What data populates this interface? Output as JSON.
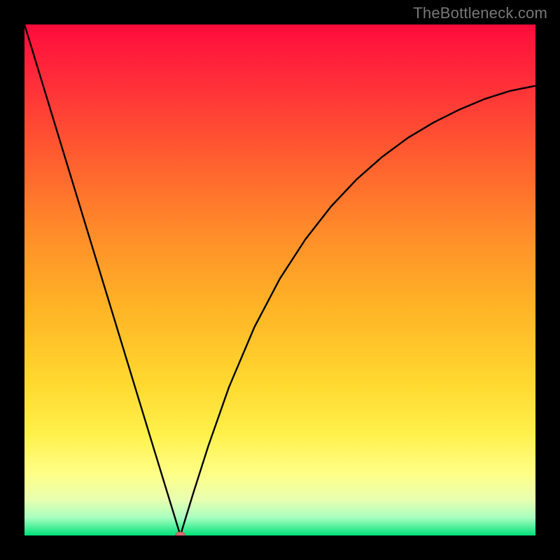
{
  "watermark": "TheBottleneck.com",
  "colors": {
    "frame": "#000000",
    "curve": "#000000",
    "marker_fill": "#d66e6f",
    "marker_stroke": "#c24e50",
    "gradient_stops": [
      {
        "offset": 0.0,
        "color": "#ff0b3c"
      },
      {
        "offset": 0.1,
        "color": "#ff2a3a"
      },
      {
        "offset": 0.25,
        "color": "#ff5a30"
      },
      {
        "offset": 0.4,
        "color": "#ff8a2a"
      },
      {
        "offset": 0.55,
        "color": "#ffb326"
      },
      {
        "offset": 0.7,
        "color": "#ffd82f"
      },
      {
        "offset": 0.8,
        "color": "#fff04a"
      },
      {
        "offset": 0.88,
        "color": "#ffff88"
      },
      {
        "offset": 0.93,
        "color": "#e8ffb0"
      },
      {
        "offset": 0.965,
        "color": "#a8ffc0"
      },
      {
        "offset": 1.0,
        "color": "#00e17a"
      }
    ]
  },
  "chart_data": {
    "type": "line",
    "title": "",
    "xlabel": "",
    "ylabel": "",
    "xlim": [
      0,
      1
    ],
    "ylim": [
      0,
      1
    ],
    "marker": {
      "x": 0.305,
      "y": 0.0
    },
    "series": [
      {
        "name": "curve",
        "x": [
          0.0,
          0.05,
          0.1,
          0.15,
          0.2,
          0.25,
          0.28,
          0.295,
          0.305,
          0.315,
          0.33,
          0.36,
          0.4,
          0.45,
          0.5,
          0.55,
          0.6,
          0.65,
          0.7,
          0.75,
          0.8,
          0.85,
          0.9,
          0.95,
          1.0
        ],
        "y": [
          1.0,
          0.836,
          0.672,
          0.508,
          0.344,
          0.18,
          0.082,
          0.033,
          0.0,
          0.033,
          0.082,
          0.176,
          0.29,
          0.408,
          0.503,
          0.58,
          0.644,
          0.697,
          0.741,
          0.778,
          0.808,
          0.833,
          0.854,
          0.87,
          0.88
        ]
      }
    ]
  }
}
